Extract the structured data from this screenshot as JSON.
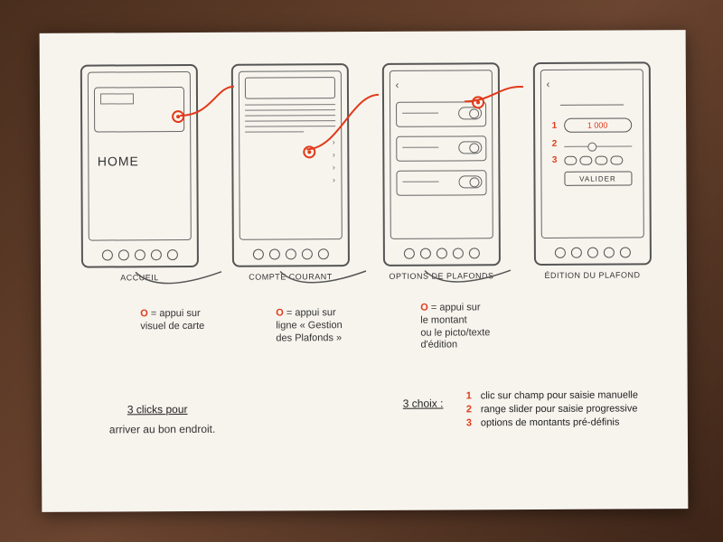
{
  "screens": [
    {
      "caption": "ACCUEIL",
      "home_label": "HOME"
    },
    {
      "caption": "COMPTE COURANT"
    },
    {
      "caption": "OPTIONS DE PLAFONDS"
    },
    {
      "caption": "ÉDITION DU PLAFOND",
      "input_value": "1 000",
      "validate_label": "VALIDER"
    }
  ],
  "annotations": {
    "a1": "= appui sur\nvisuel de carte",
    "a2": "= appui sur\nligne « Gestion\ndes Plafonds »",
    "a3": "= appui sur\nle montant\nou le picto/texte\nd'édition"
  },
  "summary_line1": "3 clicks pour",
  "summary_line2": "arriver au bon endroit.",
  "choices_title": "3 choix :",
  "choices": [
    "clic sur champ pour saisie manuelle",
    "range slider pour saisie progressive",
    "options de montants pré-définis"
  ],
  "marker_letter": "O"
}
